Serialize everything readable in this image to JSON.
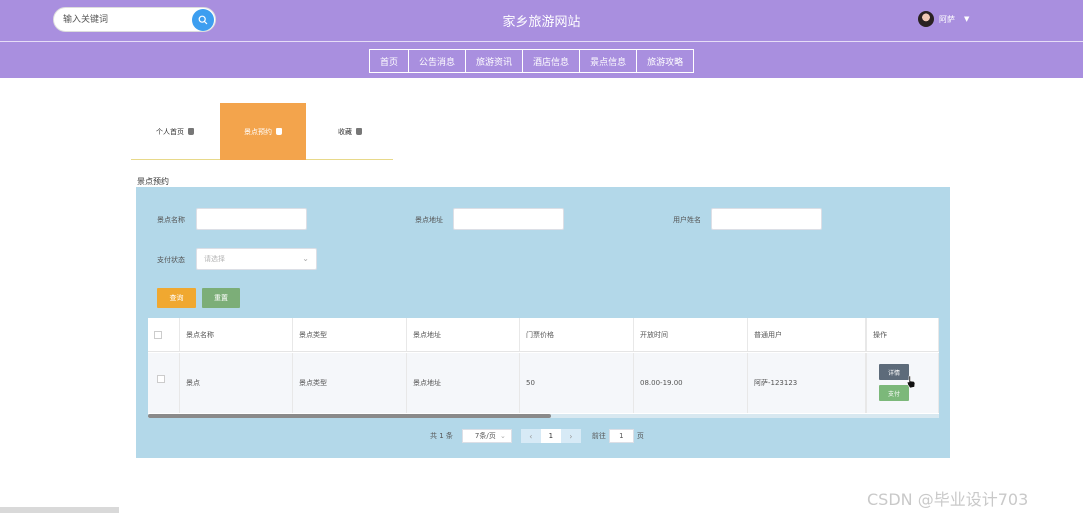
{
  "header": {
    "search": {
      "placeholder": "输入关键词"
    },
    "site_title": "家乡旅游网站",
    "user": {
      "name": "阿萨"
    }
  },
  "nav": {
    "items": [
      "首页",
      "公告消息",
      "旅游资讯",
      "酒店信息",
      "景点信息",
      "旅游攻略"
    ]
  },
  "tabs": [
    {
      "label": "个人首页"
    },
    {
      "label": "景点预约",
      "active": true
    },
    {
      "label": "收藏"
    }
  ],
  "section_title": "景点预约",
  "filters": {
    "name_label": "景点名称",
    "address_label": "景点地址",
    "user_label": "用户姓名",
    "pay_label": "支付状态",
    "pay_placeholder": "请选择",
    "query_button": "查询",
    "reset_button": "重置"
  },
  "table": {
    "headers": [
      "景点名称",
      "景点类型",
      "景点地址",
      "门票价格",
      "开放时间",
      "普通用户",
      "操作"
    ],
    "rows": [
      {
        "name": "景点",
        "type": "景点类型",
        "address": "景点地址",
        "price": "50",
        "hours": "08.00-19.00",
        "user": "阿萨-123123",
        "detail_button": "详情",
        "pay_button": "支付"
      }
    ]
  },
  "pagination": {
    "total": "共 1 条",
    "page_size": "7条/页",
    "current": "1",
    "goto_label": "前往",
    "goto_value": "1",
    "page_unit": "页"
  },
  "watermark": "CSDN @毕业设计703",
  "colors": {
    "header": "#a98fdf",
    "active_tab": "#f3a44c",
    "panel": "#b3d8e9",
    "query": "#f0a830",
    "reset": "#7cae78",
    "detail": "#5d6b7a",
    "pay": "#7cb87a"
  }
}
